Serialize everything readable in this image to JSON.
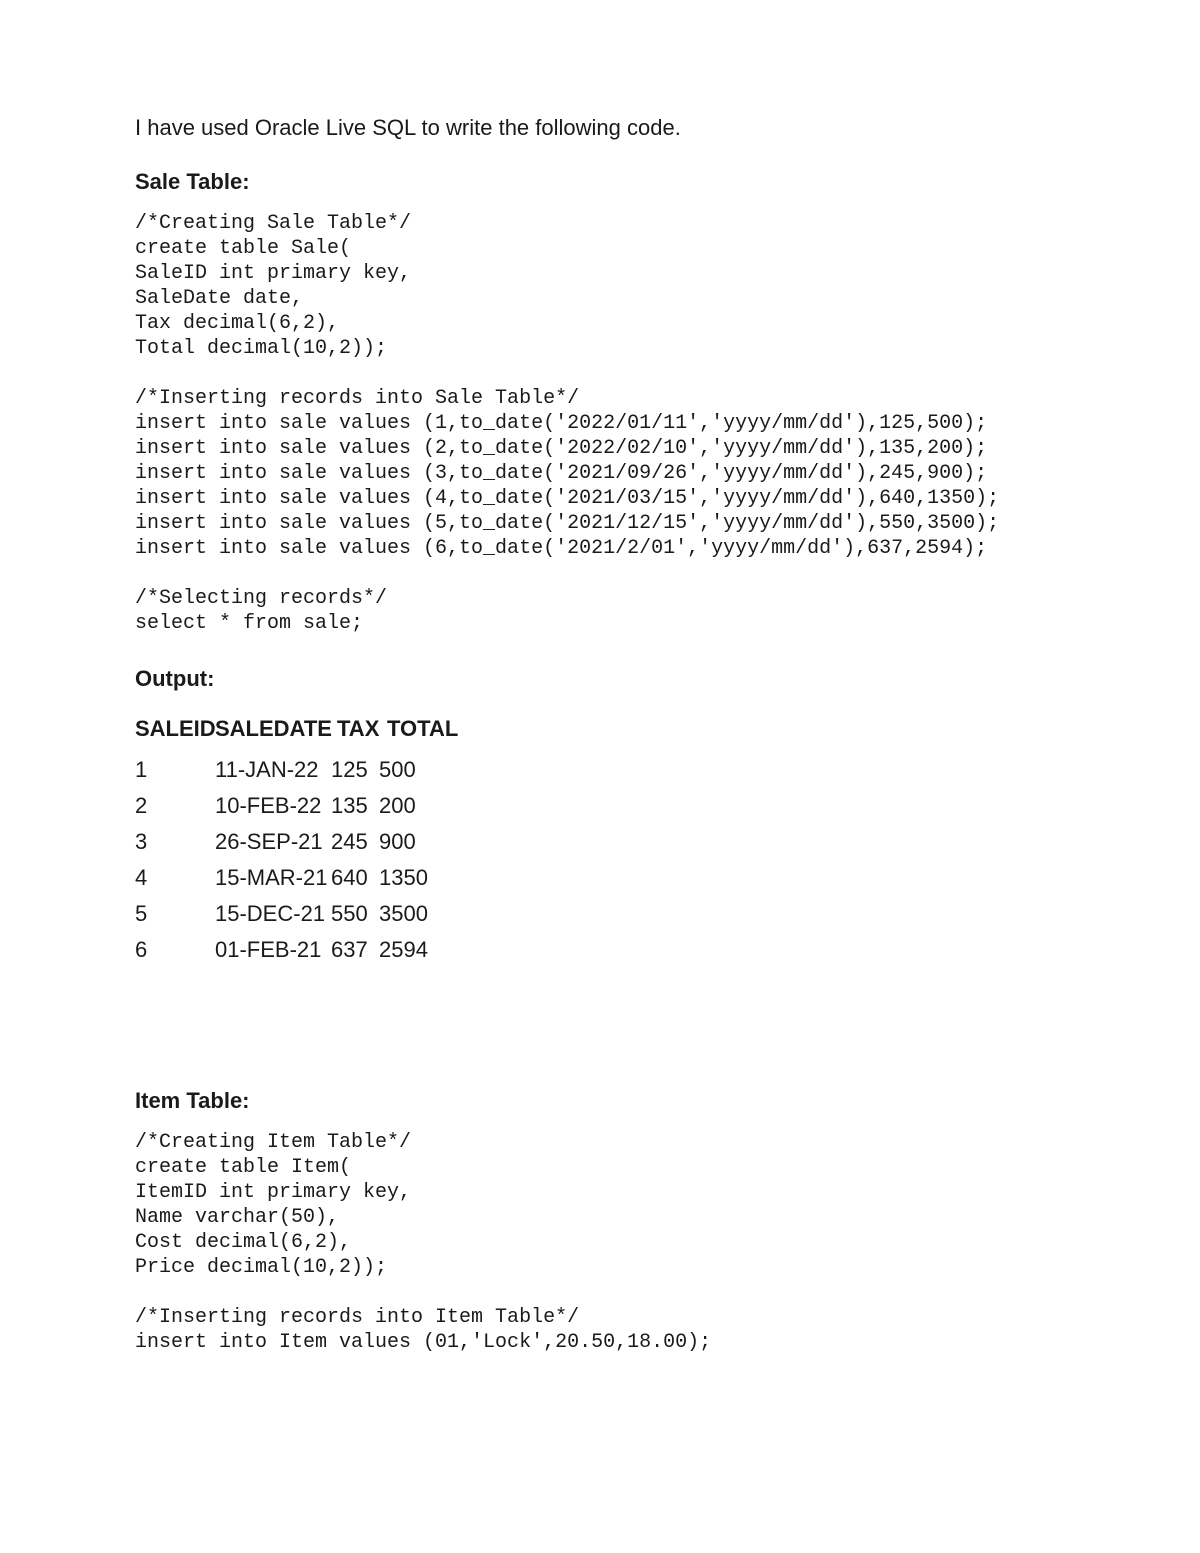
{
  "intro": "I have used Oracle Live SQL to write the following code.",
  "sale": {
    "heading": "Sale Table:",
    "code": "/*Creating Sale Table*/\ncreate table Sale(\nSaleID int primary key,\nSaleDate date,\nTax decimal(6,2),\nTotal decimal(10,2));\n\n/*Inserting records into Sale Table*/\ninsert into sale values (1,to_date('2022/01/11','yyyy/mm/dd'),125,500);\ninsert into sale values (2,to_date('2022/02/10','yyyy/mm/dd'),135,200);\ninsert into sale values (3,to_date('2021/09/26','yyyy/mm/dd'),245,900);\ninsert into sale values (4,to_date('2021/03/15','yyyy/mm/dd'),640,1350);\ninsert into sale values (5,to_date('2021/12/15','yyyy/mm/dd'),550,3500);\ninsert into sale values (6,to_date('2021/2/01','yyyy/mm/dd'),637,2594);\n\n/*Selecting records*/\nselect * from sale;"
  },
  "output": {
    "heading": "Output:",
    "columns": {
      "id": "SALEID",
      "date": "SALEDATE",
      "tax": "TAX",
      "total": "TOTAL"
    },
    "rows": [
      {
        "id": "1",
        "date": "11-JAN-22",
        "tax": "125",
        "total": "500"
      },
      {
        "id": "2",
        "date": "10-FEB-22",
        "tax": "135",
        "total": "200"
      },
      {
        "id": "3",
        "date": "26-SEP-21",
        "tax": "245",
        "total": "900"
      },
      {
        "id": "4",
        "date": "15-MAR-21",
        "tax": "640",
        "total": "1350"
      },
      {
        "id": "5",
        "date": "15-DEC-21",
        "tax": "550",
        "total": "3500"
      },
      {
        "id": "6",
        "date": "01-FEB-21",
        "tax": "637",
        "total": "2594"
      }
    ]
  },
  "item": {
    "heading": "Item Table:",
    "code": "/*Creating Item Table*/\ncreate table Item(\nItemID int primary key,\nName varchar(50),\nCost decimal(6,2),\nPrice decimal(10,2));\n\n/*Inserting records into Item Table*/\ninsert into Item values (01,'Lock',20.50,18.00);"
  }
}
